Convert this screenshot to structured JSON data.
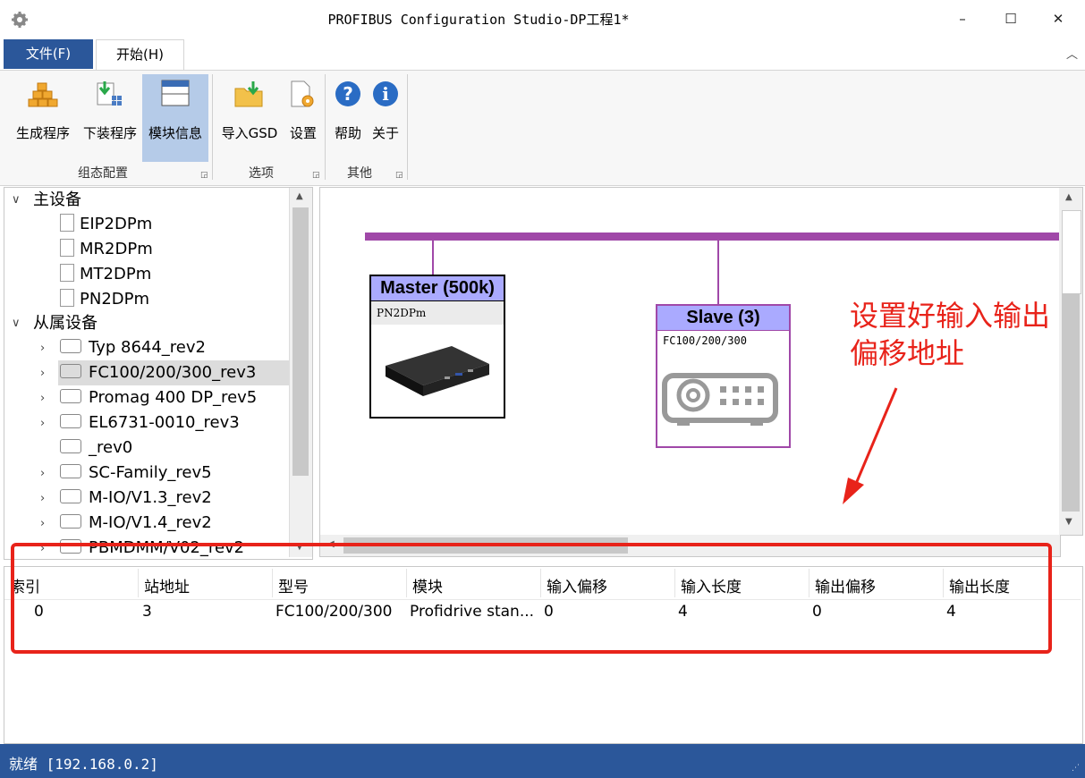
{
  "window": {
    "title": "PROFIBUS Configuration Studio-DP工程1*",
    "minimize": "–",
    "maximize": "☐",
    "close": "✕"
  },
  "tabs": {
    "file": "文件(F)",
    "start": "开始(H)",
    "collapse": "︿"
  },
  "ribbon": {
    "buttons": [
      {
        "label": "生成程序",
        "icon": "build-icon"
      },
      {
        "label": "下装程序",
        "icon": "download-icon"
      },
      {
        "label": "模块信息",
        "icon": "window-icon"
      },
      {
        "label": "导入GSD",
        "icon": "import-folder-icon"
      },
      {
        "label": "设置",
        "icon": "settings-doc-icon"
      },
      {
        "label": "帮助",
        "icon": "help-icon"
      },
      {
        "label": "关于",
        "icon": "info-icon"
      }
    ],
    "groups": [
      "组态配置",
      "选项",
      "其他"
    ]
  },
  "tree": {
    "master_label": "主设备",
    "masters": [
      "EIP2DPm",
      "MR2DPm",
      "MT2DPm",
      "PN2DPm"
    ],
    "slave_label": "从属设备",
    "slaves": [
      "Typ 8644_rev2",
      "FC100/200/300_rev3",
      "Promag 400 DP_rev5",
      "EL6731-0010_rev3",
      "_rev0",
      "SC-Family_rev5",
      "M-IO/V1.3_rev2",
      "M-IO/V1.4_rev2",
      "PBMDMM/V02_rev2"
    ]
  },
  "canvas": {
    "master": {
      "title": "Master (500k)",
      "model": "PN2DPm"
    },
    "slave": {
      "title": "Slave (3)",
      "model": "FC100/200/300"
    },
    "annotation_line1": "设置好输入输出",
    "annotation_line2": "偏移地址",
    "bus_color": "#a048a8",
    "annotation_color": "#e8231a"
  },
  "grid": {
    "headers": [
      "索引",
      "站地址",
      "型号",
      "模块",
      "输入偏移",
      "输入长度",
      "输出偏移",
      "输出长度"
    ],
    "rows": [
      [
        "0",
        "3",
        "FC100/200/300",
        "Profidrive stan...",
        "0",
        "4",
        "0",
        "4"
      ]
    ]
  },
  "status": {
    "text": "就绪 [192.168.0.2]"
  }
}
